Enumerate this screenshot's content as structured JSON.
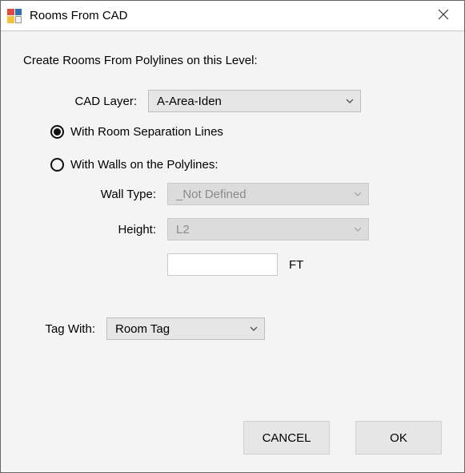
{
  "window": {
    "title": "Rooms From CAD"
  },
  "prompt": "Create Rooms From Polylines on this Level:",
  "cad_layer": {
    "label": "CAD Layer:",
    "value": "A-Area-Iden"
  },
  "radio_separation": {
    "label": "With Room Separation Lines",
    "checked": true
  },
  "radio_walls": {
    "label": "With Walls on the Polylines:",
    "checked": false
  },
  "wall_type": {
    "label": "Wall Type:",
    "value": "_Not Defined"
  },
  "height": {
    "label": "Height:",
    "value": "L2",
    "input_value": "",
    "unit": "FT"
  },
  "tag_with": {
    "label": "Tag With:",
    "value": "Room Tag"
  },
  "buttons": {
    "cancel": "CANCEL",
    "ok": "OK"
  }
}
